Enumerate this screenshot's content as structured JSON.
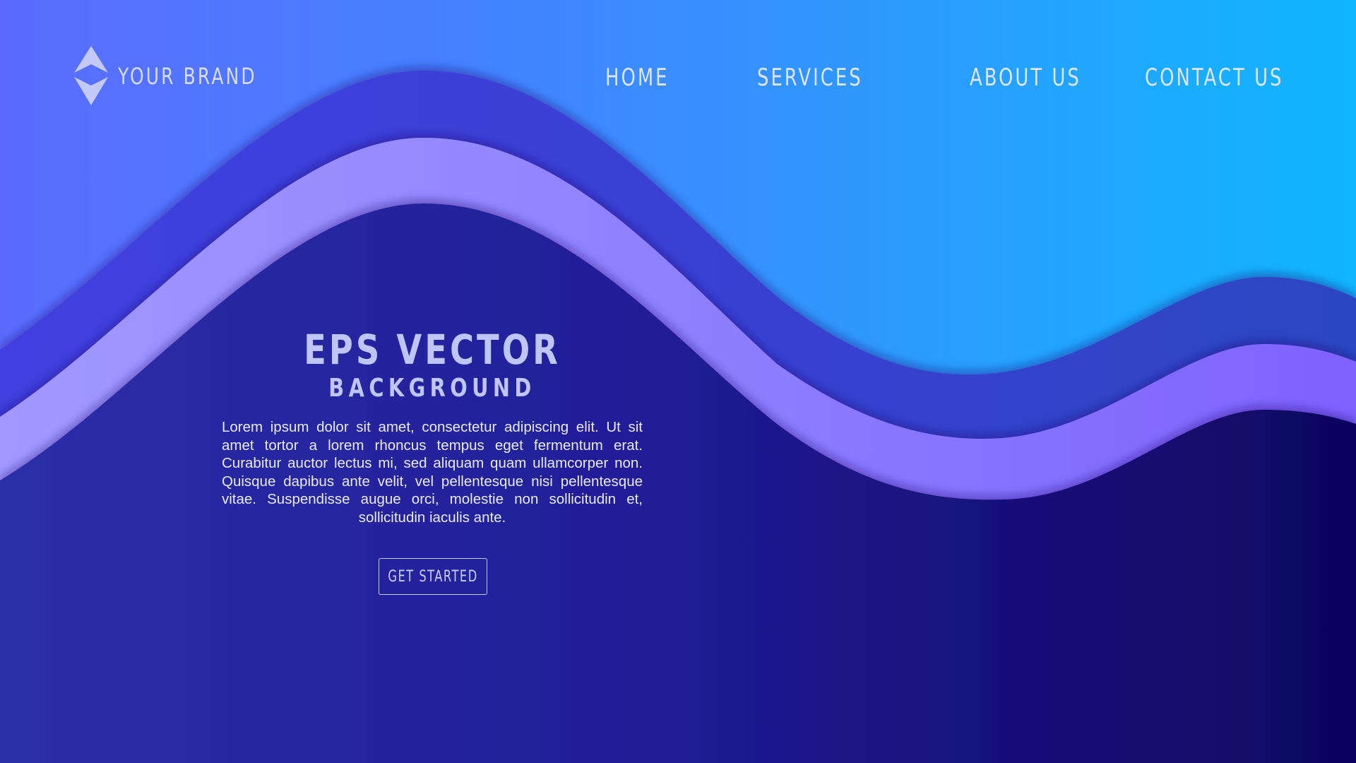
{
  "brand": {
    "name": "YOUR BRAND",
    "logo_icon": "diamond-logo-icon"
  },
  "nav": {
    "items": [
      {
        "label": "HOME"
      },
      {
        "label": "SERVICES"
      },
      {
        "label": "ABOUT US"
      },
      {
        "label": "CONTACT US"
      }
    ]
  },
  "hero": {
    "title": "EPS VECTOR",
    "subtitle": "BACKGROUND",
    "body": "Lorem ipsum dolor sit amet, consectetur adipiscing elit. Ut sit amet tortor a lorem rhoncus tempus eget fermentum erat. Curabitur auctor lectus mi, sed aliquam quam ullamcorper non. Quisque dapibus ante velit, vel pellentesque nisi pellentesque vitae. Suspendisse augue orci, molestie non sollicitudin et, sollicitudin iaculis ante.",
    "cta_label": "GET STARTED"
  },
  "colors": {
    "sky_left": "#5b6bff",
    "sky_right": "#10b6fe",
    "wave_band_dark": "#3a3fd6",
    "wave_band_light": "#9a8cff",
    "base_left": "#2a2aa6",
    "base_right": "#100663",
    "text_light": "#dde5fb"
  }
}
